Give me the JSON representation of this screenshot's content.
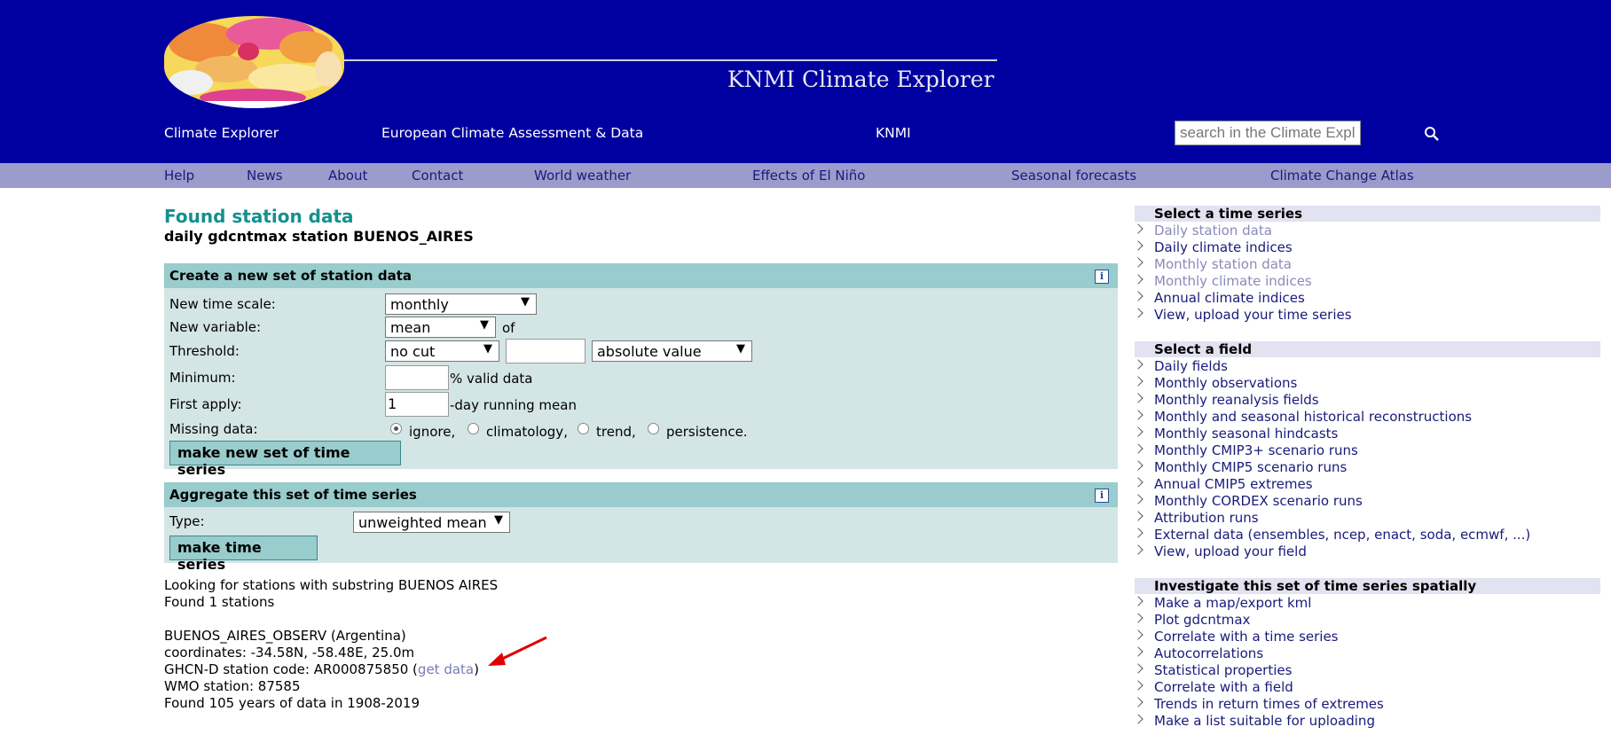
{
  "header": {
    "site_title": "KNMI Climate Explorer",
    "links": [
      "Climate Explorer",
      "European Climate Assessment & Data",
      "KNMI"
    ],
    "search_placeholder": "search in the Climate Explorer",
    "bg_color": "#0000a0"
  },
  "nav": [
    "Help",
    "News",
    "About",
    "Contact",
    "World weather",
    "Effects of El Niño",
    "Seasonal forecasts",
    "Climate Change Atlas"
  ],
  "page": {
    "title": "Found station data",
    "subtitle": "daily gdcntmax station BUENOS_AIRES"
  },
  "create_panel": {
    "title": "Create a new set of station data",
    "info": "i",
    "time_scale_label": "New time scale:",
    "time_scale_value": "monthly",
    "variable_label": "New variable:",
    "variable_value": "mean",
    "variable_suffix": "of",
    "threshold_label": "Threshold:",
    "threshold_cut": "no cut",
    "threshold_value": "",
    "threshold_mode": "absolute value",
    "minimum_label": "Minimum:",
    "minimum_value": "",
    "minimum_suffix": "% valid data",
    "first_apply_label": "First apply:",
    "first_apply_value": "1",
    "first_apply_suffix": "-day running mean",
    "missing_label": "Missing data:",
    "missing_options": [
      "ignore,",
      "climatology,",
      "trend,",
      "persistence."
    ],
    "missing_selected": "ignore,",
    "submit": "make new set of time series"
  },
  "aggregate_panel": {
    "title": "Aggregate this set of time series",
    "info": "i",
    "type_label": "Type:",
    "type_value": "unweighted mean",
    "submit": "make time series"
  },
  "results": {
    "search_line": "Looking for stations with substring BUENOS AIRES",
    "found_line": "Found 1 stations",
    "station_name": "BUENOS_AIRES_OBSERV (Argentina)",
    "coordinates": "coordinates: -34.58N, -58.48E, 25.0m",
    "code_prefix": "GHCN-D station code: AR000875850 (",
    "get_data": "get data",
    "code_suffix": ")",
    "wmo": "WMO station: 87585",
    "years": "Found 105 years of data in 1908-2019"
  },
  "sidebar": {
    "time_series": {
      "heading": "Select a time series",
      "items": [
        "Daily station data",
        "Daily climate indices",
        "Monthly station data",
        "Monthly climate indices",
        "Annual climate indices",
        "View, upload your time series"
      ]
    },
    "field": {
      "heading": "Select a field",
      "items": [
        "Daily fields",
        "Monthly observations",
        "Monthly reanalysis fields",
        "Monthly and seasonal historical reconstructions",
        "Monthly seasonal hindcasts",
        "Monthly CMIP3+ scenario runs",
        "Monthly CMIP5 scenario runs",
        "Annual CMIP5 extremes",
        "Monthly CORDEX scenario runs",
        "Attribution runs",
        "External data (ensembles, ncep, enact, soda, ecmwf, ...)",
        "View, upload your field"
      ]
    },
    "investigate": {
      "heading": "Investigate this set of time series spatially",
      "items": [
        "Make a map/export kml",
        "Plot gdcntmax",
        "Correlate with a time series",
        "Autocorrelations",
        "Statistical properties",
        "Correlate with a field",
        "Trends in return times of extremes",
        "Make a list suitable for uploading"
      ]
    }
  }
}
